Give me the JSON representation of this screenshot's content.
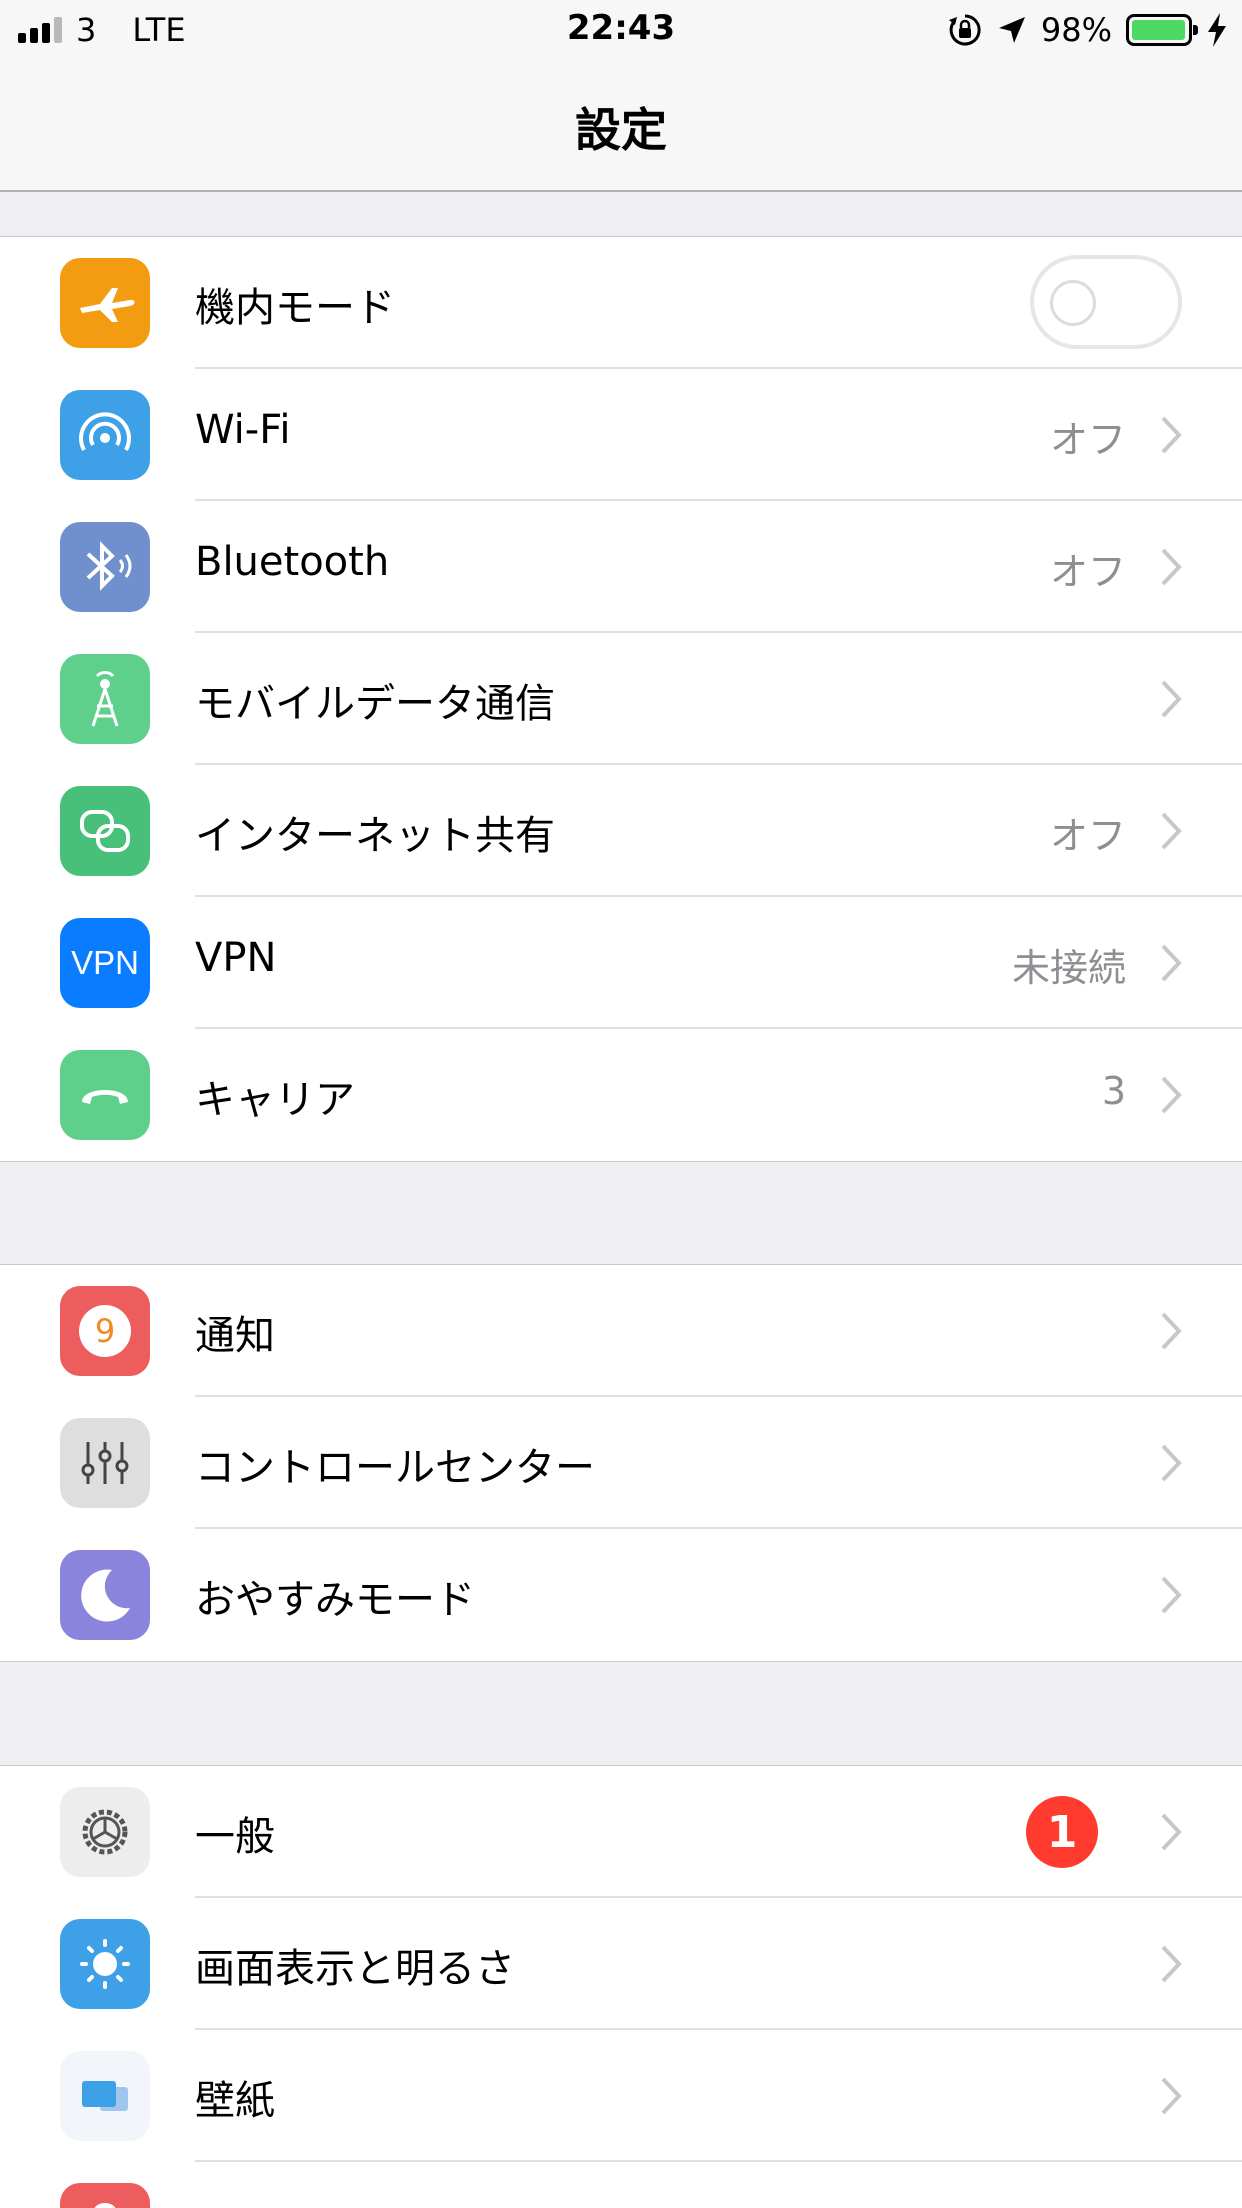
{
  "status_bar": {
    "carrier": "3",
    "network": "LTE",
    "time": "22:43",
    "battery": "98%",
    "battery_level": 0.98
  },
  "nav": {
    "title": "設定"
  },
  "groups": [
    {
      "rows": [
        {
          "label": "機内モード",
          "icon": "airplane-icon",
          "color": "#f39c12",
          "toggle": false
        },
        {
          "label": "Wi-Fi",
          "value": "オフ",
          "icon": "wifi-icon",
          "color": "#3ea0e6"
        },
        {
          "label": "Bluetooth",
          "value": "オフ",
          "icon": "bluetooth-icon",
          "color": "#6f8fcd"
        },
        {
          "label": "モバイルデータ通信",
          "value": "",
          "icon": "cellular-icon",
          "color": "#5fcf8c"
        },
        {
          "label": "インターネット共有",
          "value": "オフ",
          "icon": "hotspot-icon",
          "color": "#48c07a"
        },
        {
          "label": "VPN",
          "value": "未接続",
          "icon": "vpn-icon",
          "icon_text": "VPN",
          "color": "#0a7cff"
        },
        {
          "label": "キャリア",
          "value": "3",
          "icon": "phone-icon",
          "color": "#5fcf8c"
        }
      ]
    },
    {
      "rows": [
        {
          "label": "通知",
          "icon": "notifications-icon",
          "icon_text": "9",
          "color": "#ee5d5d"
        },
        {
          "label": "コントロールセンター",
          "icon": "control-center-icon",
          "color": "#dedede"
        },
        {
          "label": "おやすみモード",
          "icon": "moon-icon",
          "color": "#8a84dc"
        }
      ]
    },
    {
      "rows": [
        {
          "label": "一般",
          "badge": "1",
          "icon": "gear-icon",
          "color": "#ededed"
        },
        {
          "label": "画面表示と明るさ",
          "icon": "brightness-icon",
          "color": "#3ea0e6"
        },
        {
          "label": "壁紙",
          "icon": "wallpaper-icon",
          "color": "#f2f6fa"
        },
        {
          "label": "",
          "icon": "sounds-icon",
          "color": "#ee5d5d"
        }
      ]
    }
  ]
}
